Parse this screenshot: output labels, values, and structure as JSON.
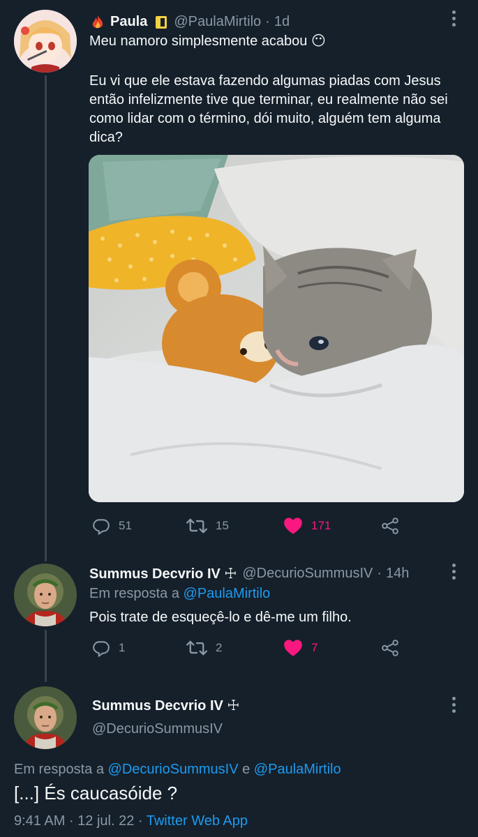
{
  "tweets": [
    {
      "name": "Paula",
      "handle": "@PaulaMirtilo",
      "time": "1d",
      "text_line1": "Meu namoro simplesmente acabou 😶",
      "text_body": "Eu vi que ele estava fazendo algumas piadas com Jesus então infelizmente tive que terminar, eu realmente não sei como lidar com o término, dói muito, alguém tem alguma dica?",
      "replies": "51",
      "retweets": "15",
      "likes": "171"
    },
    {
      "name": "Summus Decvrio IV ☩",
      "handle": "@DecurioSummusIV",
      "time": "14h",
      "reply_prefix": "Em resposta a",
      "reply_to": "@PaulaMirtilo",
      "text": "Pois trate de esqueçê-lo e dê-me um filho.",
      "replies": "1",
      "retweets": "2",
      "likes": "7"
    }
  ],
  "focused": {
    "name": "Summus Decvrio IV ☩",
    "handle": "@DecurioSummusIV",
    "reply_prefix": "Em resposta a",
    "reply_to_1": "@DecurioSummusIV",
    "reply_and": "e",
    "reply_to_2": "@PaulaMirtilo",
    "text": "[...] És caucasóide ?",
    "timestamp": "9:41 AM · 12 jul. 22 ·",
    "source": "Twitter Web App"
  },
  "colors": {
    "background": "#15202b",
    "muted": "#8b98a5",
    "link": "#1d9bf0",
    "like": "#f91880"
  }
}
